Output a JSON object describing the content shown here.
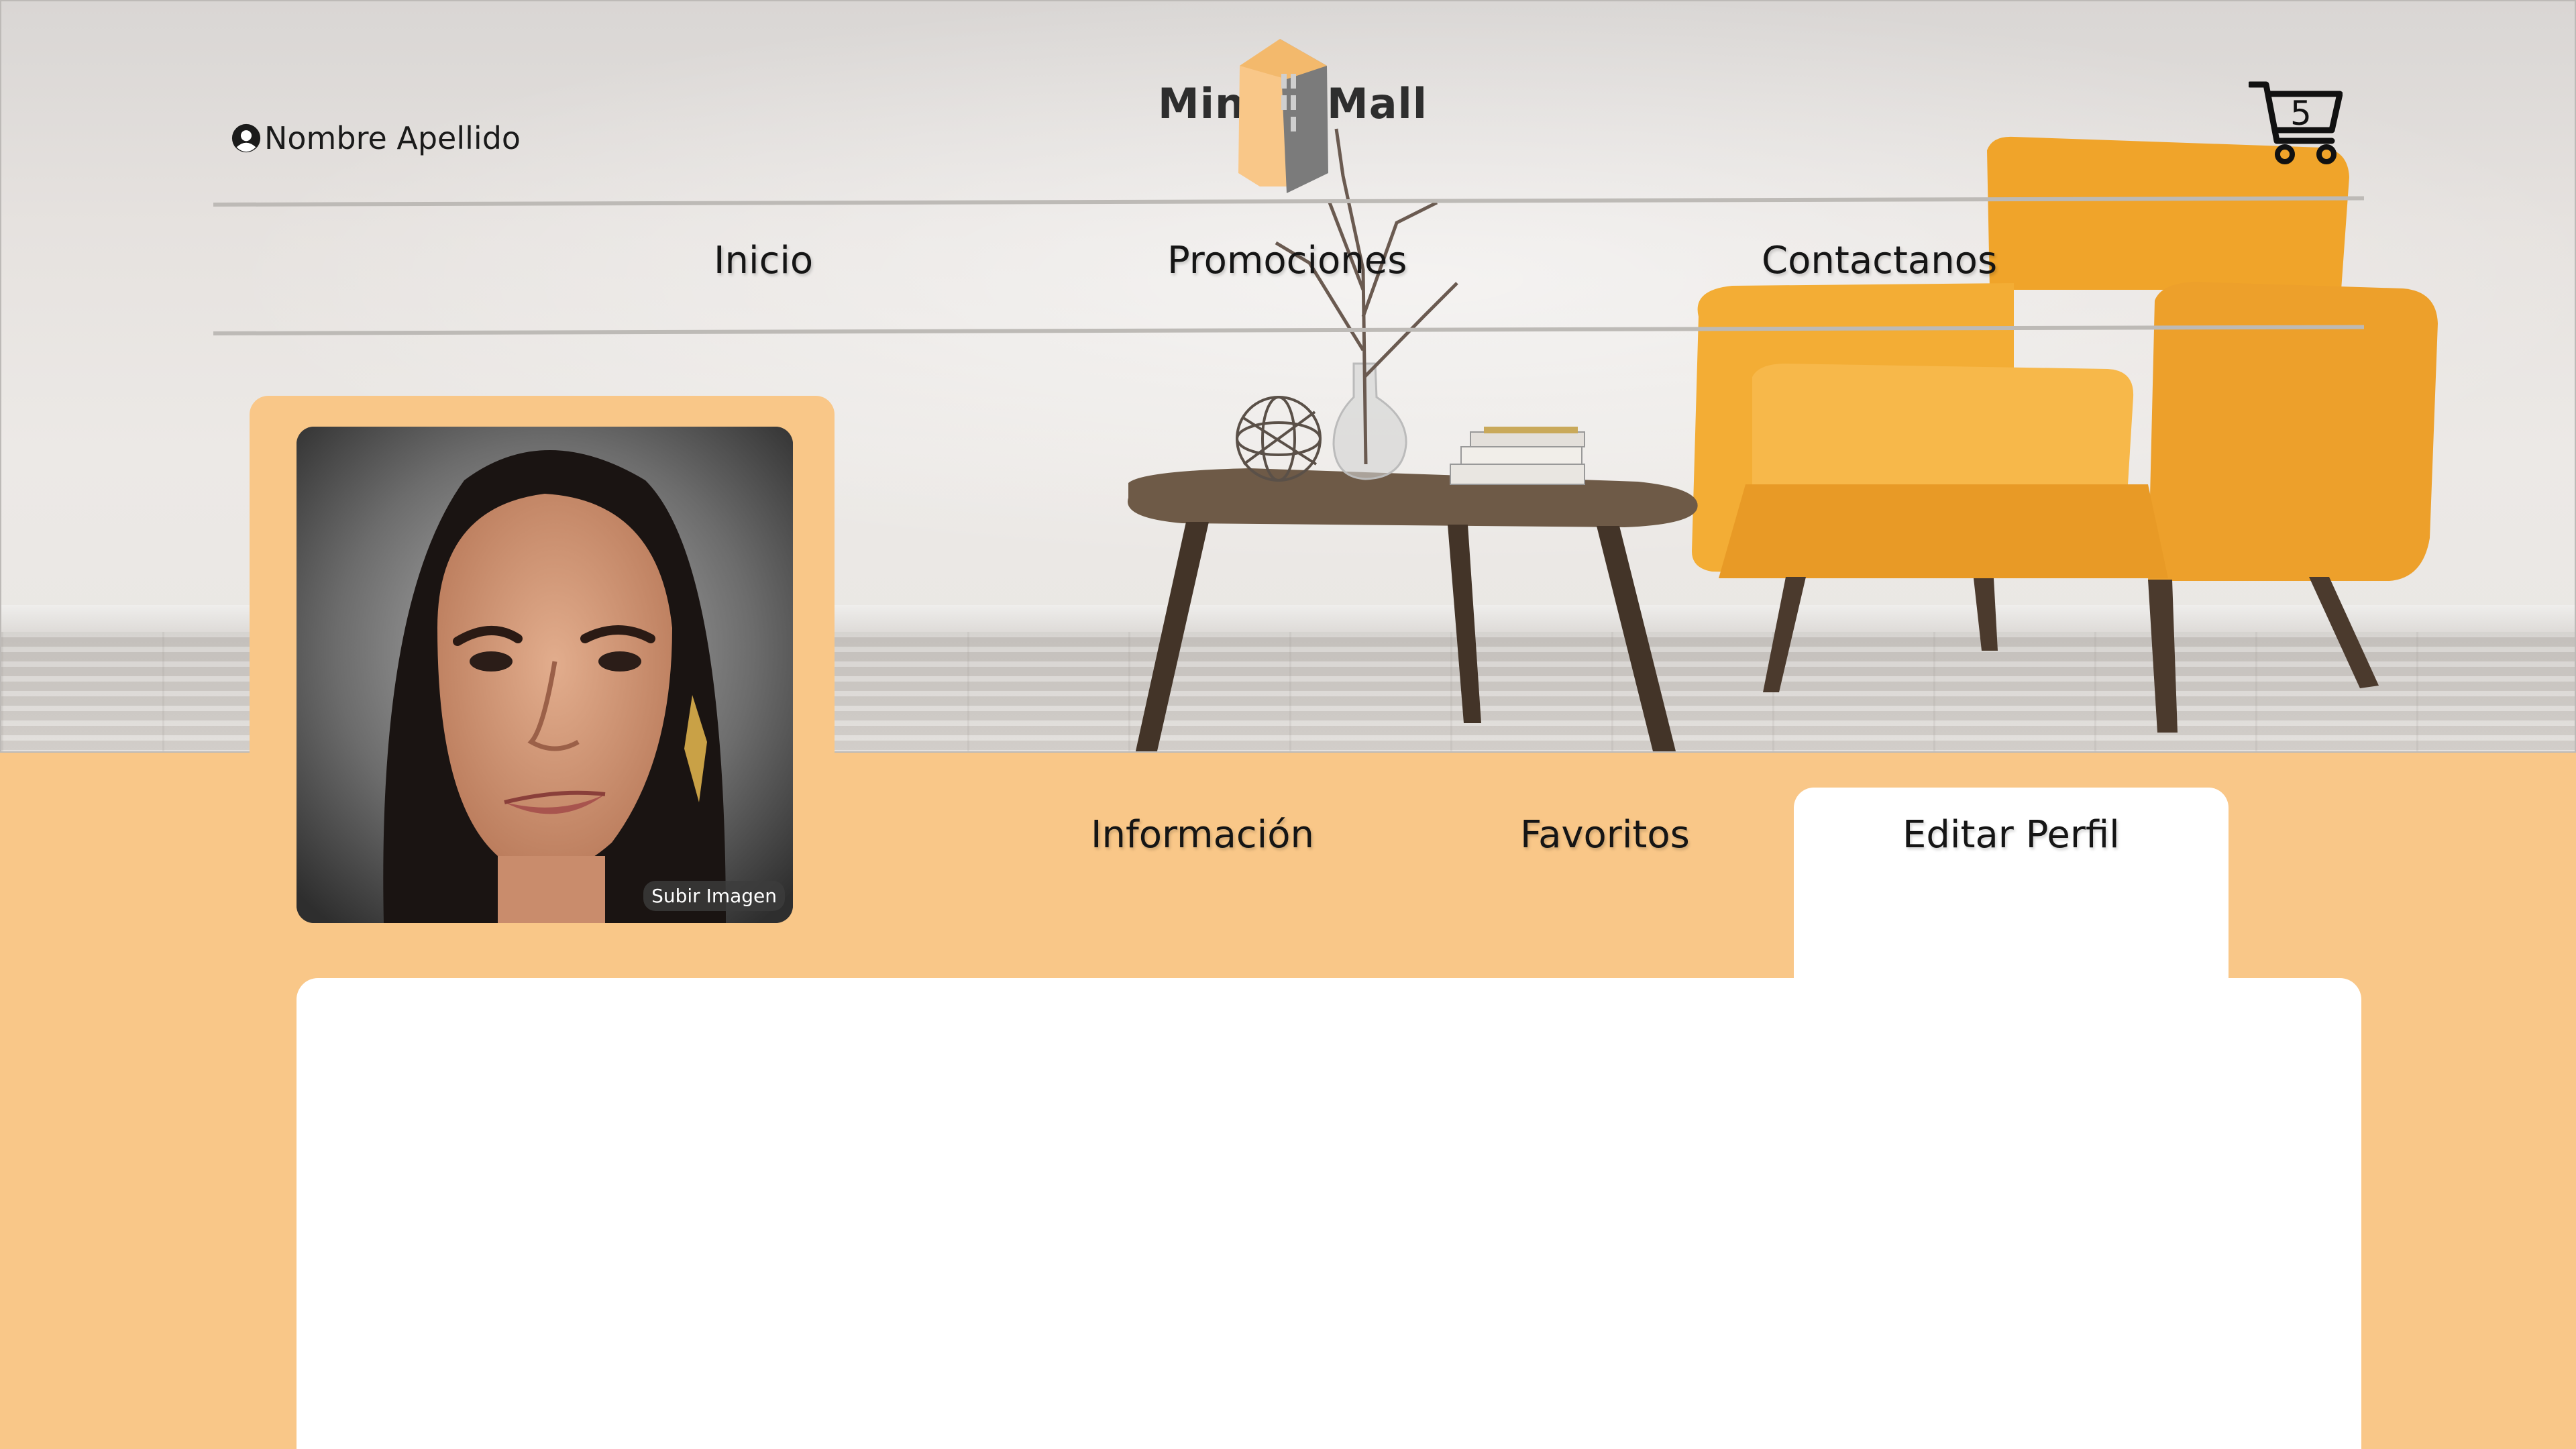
{
  "header": {
    "user_name": "Nombre Apellido",
    "logo": {
      "left_word": "Mini",
      "right_word": "Mall"
    },
    "cart_count": "5"
  },
  "nav": {
    "items": [
      {
        "label": "Inicio"
      },
      {
        "label": "Promociones"
      },
      {
        "label": "Contactanos"
      }
    ]
  },
  "profile": {
    "upload_label": "Subir Imagen",
    "tabs": [
      {
        "label": "Información"
      },
      {
        "label": "Favoritos"
      },
      {
        "label": "Editar Perfil",
        "active": true
      }
    ]
  },
  "colors": {
    "accent": "#f9c788",
    "panel": "#ffffff",
    "text": "#151515"
  },
  "icons": {
    "user": "user-circle-icon",
    "cart": "shopping-cart-icon"
  }
}
